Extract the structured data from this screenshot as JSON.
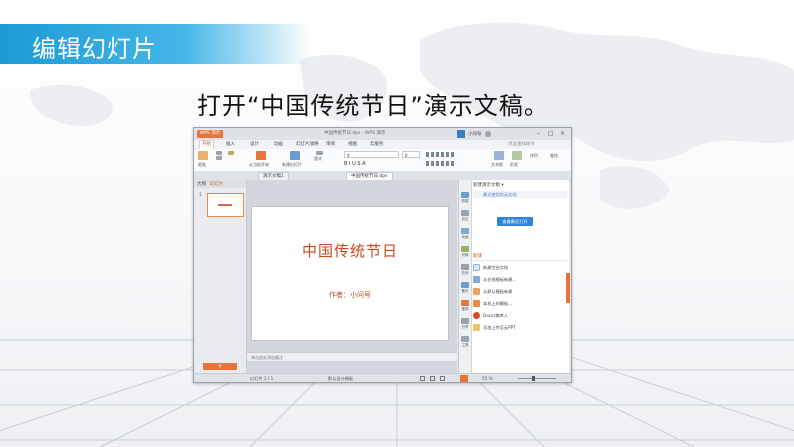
{
  "page": {
    "heading": "编辑幻灯片",
    "instruction": "打开“中国传统节日”演示文稿。"
  },
  "window": {
    "app_button": "WPS 演示",
    "title": "中国传统节日.dps - WPS 演示",
    "user": "小问号",
    "menus": [
      "开始",
      "插入",
      "设计",
      "动画",
      "幻灯片放映",
      "审阅",
      "视图",
      "云服务"
    ],
    "active_menu": "开始",
    "ribbon": {
      "paste": "粘贴",
      "from_current": "从当前开始",
      "new_slide": "新建幻灯片",
      "layout": "版式",
      "text_box": "文本框",
      "shape": "形状",
      "arrange": "排列",
      "find": "查找",
      "font_value": "0",
      "size_value": "0",
      "search_placeholder": "点此查找命令"
    },
    "doc_tabs": [
      "演示文稿1",
      "中国传统节日.dps"
    ],
    "pane_tabs": [
      "大纲",
      "幻灯片"
    ],
    "slide_number": "1",
    "add_slide": "+",
    "slide": {
      "title": "中国传统节日",
      "author": "作者：小问号"
    },
    "notes_placeholder": "单击此处添加备注",
    "taskpane": {
      "header": "新建演示文稿 ▾",
      "recent": "最近使用的云文档",
      "open_button": "查看最近打开",
      "section": "新建",
      "items": [
        "新建空白文档",
        "从在线模板新建...",
        "从默认模板新建",
        "本机上的模板...",
        "Docer稿库入",
        "添加上传至云PPT"
      ],
      "side_icons": [
        "新建",
        "自定",
        "动画",
        "切换",
        "形状",
        "备份",
        "推荐",
        "分享",
        "工具"
      ]
    },
    "status": {
      "page": "幻灯片 1 / 1",
      "template": "默认设计模板",
      "zoom": "55 %"
    }
  },
  "colors": {
    "accent": "#e8743b",
    "title_bar": "#1a9ad6",
    "slide_title": "#c9471a"
  }
}
